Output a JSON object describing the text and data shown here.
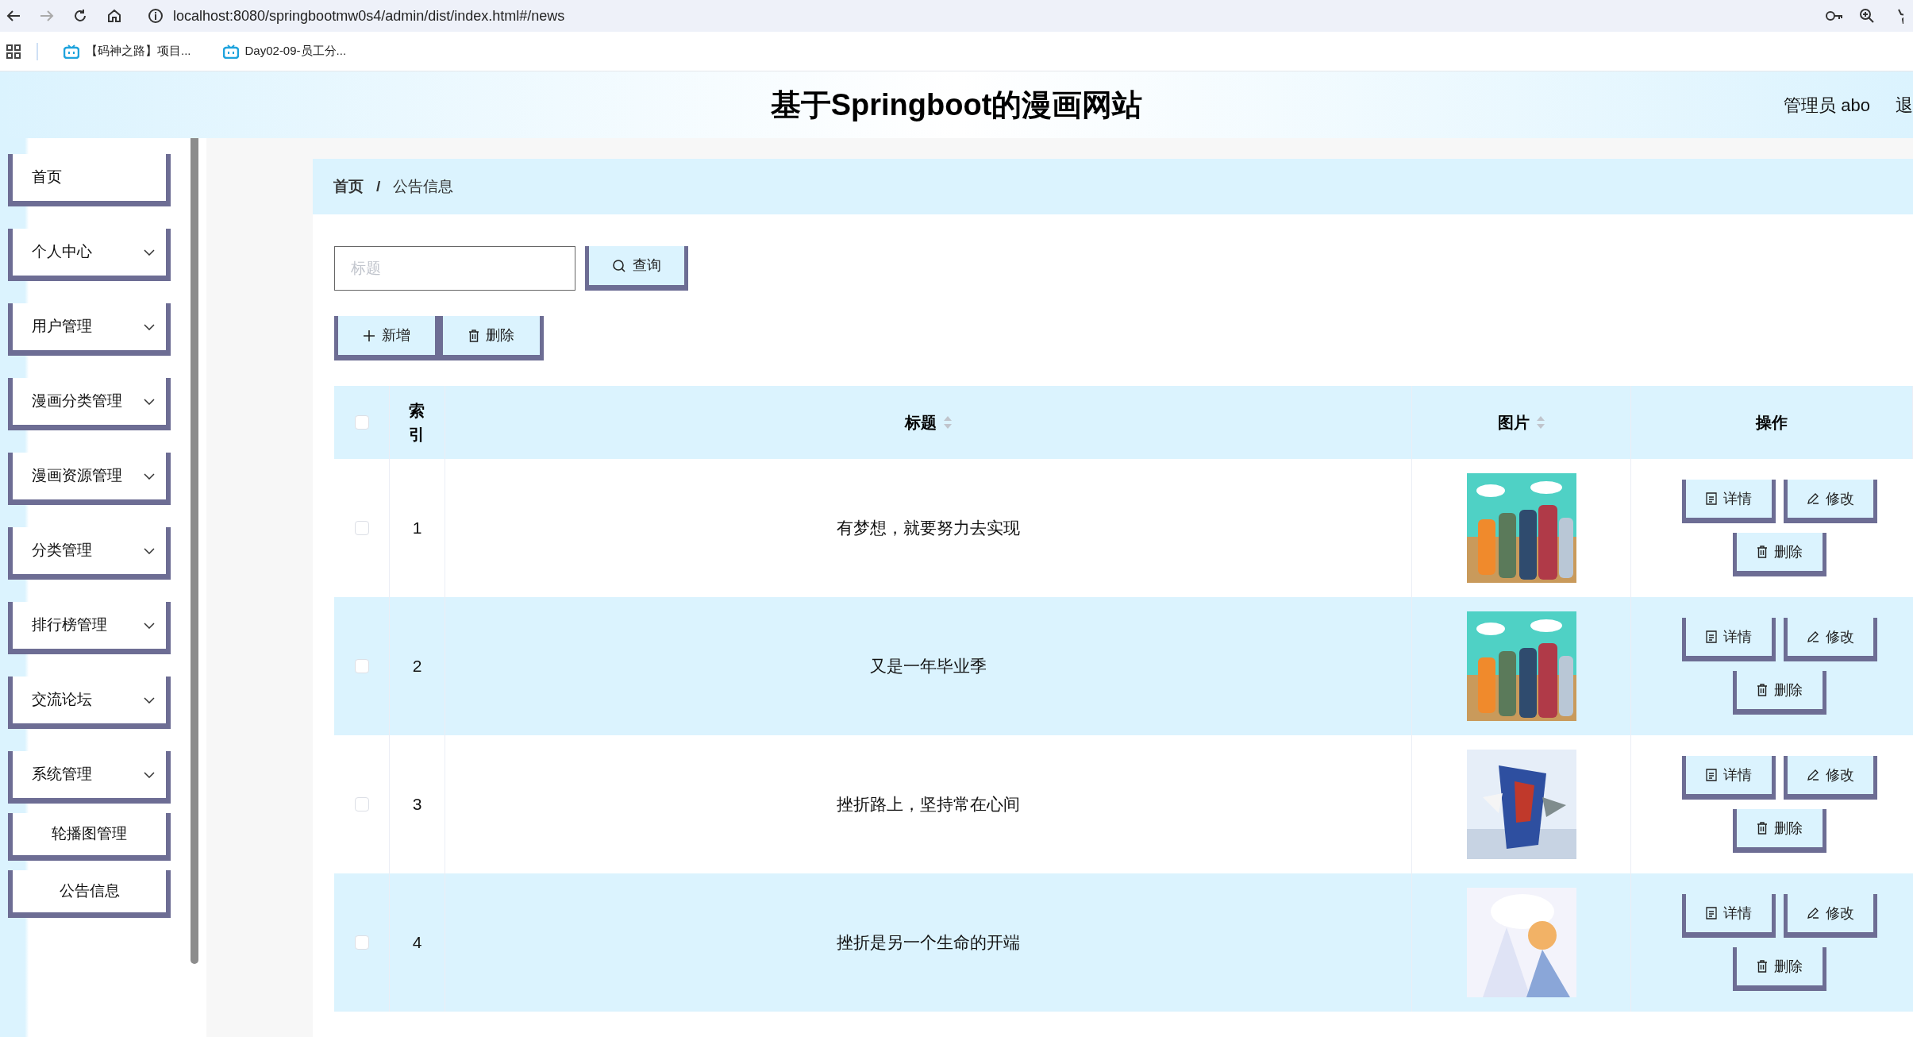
{
  "browser": {
    "url": "localhost:8080/springbootmw0s4/admin/dist/index.html#/news",
    "bookmarks": [
      "【码神之路】项目...",
      "Day02-09-员工分..."
    ]
  },
  "header": {
    "title": "基于Springboot的漫画网站",
    "user": "管理员 abo",
    "logout": "退"
  },
  "sidebar": {
    "items": [
      {
        "label": "首页",
        "kind": "home"
      },
      {
        "label": "个人中心",
        "kind": "submenu"
      },
      {
        "label": "用户管理",
        "kind": "submenu"
      },
      {
        "label": "漫画分类管理",
        "kind": "submenu"
      },
      {
        "label": "漫画资源管理",
        "kind": "submenu"
      },
      {
        "label": "分类管理",
        "kind": "submenu"
      },
      {
        "label": "排行榜管理",
        "kind": "submenu"
      },
      {
        "label": "交流论坛",
        "kind": "submenu"
      },
      {
        "label": "系统管理",
        "kind": "submenu"
      },
      {
        "label": "轮播图管理",
        "kind": "link"
      },
      {
        "label": "公告信息",
        "kind": "link"
      }
    ]
  },
  "breadcrumb": {
    "items": [
      "首页",
      "公告信息"
    ],
    "separator": "/"
  },
  "search": {
    "placeholder": "标题",
    "button": "查询"
  },
  "actions": {
    "add": "新增",
    "delete": "删除"
  },
  "table": {
    "select_all_checked": false,
    "columns": [
      {
        "label": "索引",
        "sortable": false
      },
      {
        "label": "标题",
        "sortable": true
      },
      {
        "label": "图片",
        "sortable": true
      },
      {
        "label": "操作",
        "sortable": false
      }
    ],
    "rows": [
      {
        "index": "1",
        "title": "有梦想，就要努力去实现",
        "checked": false,
        "buttons": [
          "详情",
          "修改",
          "删除"
        ]
      },
      {
        "index": "2",
        "title": "又是一年毕业季",
        "checked": false,
        "buttons": [
          "详情",
          "修改",
          "删除"
        ]
      },
      {
        "index": "3",
        "title": "挫折路上，坚持常在心间",
        "checked": false,
        "buttons": [
          "详情",
          "修改",
          "删除"
        ]
      },
      {
        "index": "4",
        "title": "挫折是另一个生命的开端",
        "checked": false,
        "buttons": [
          "详情",
          "修改",
          "删除"
        ]
      }
    ]
  }
}
